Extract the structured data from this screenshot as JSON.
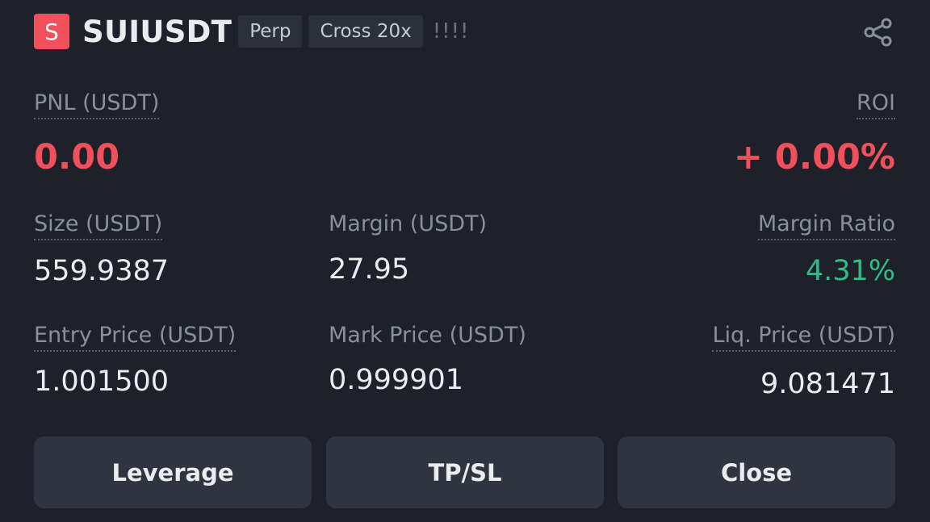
{
  "header": {
    "symbol_icon_letter": "S",
    "symbol": "SUIUSDT",
    "tags": [
      "Perp",
      "Cross 20x"
    ],
    "signal": "!!!!"
  },
  "pnl": {
    "label": "PNL (USDT)",
    "value": "0.00"
  },
  "roi": {
    "label": "ROI",
    "value": "+ 0.00%"
  },
  "size": {
    "label": "Size (USDT)",
    "value": "559.9387"
  },
  "margin": {
    "label": "Margin (USDT)",
    "value": "27.95"
  },
  "margin_ratio": {
    "label": "Margin Ratio",
    "value": "4.31%"
  },
  "entry_price": {
    "label": "Entry Price (USDT)",
    "value": "1.001500"
  },
  "mark_price": {
    "label": "Mark Price (USDT)",
    "value": "0.999901"
  },
  "liq_price": {
    "label": "Liq. Price (USDT)",
    "value": "9.081471"
  },
  "buttons": {
    "leverage": "Leverage",
    "tpsl": "TP/SL",
    "close": "Close"
  },
  "colors": {
    "negative": "#f0505c",
    "positive": "#2ebd85",
    "background": "#1e2129",
    "button": "#2f3440"
  },
  "icons": {
    "share": "share-icon"
  }
}
